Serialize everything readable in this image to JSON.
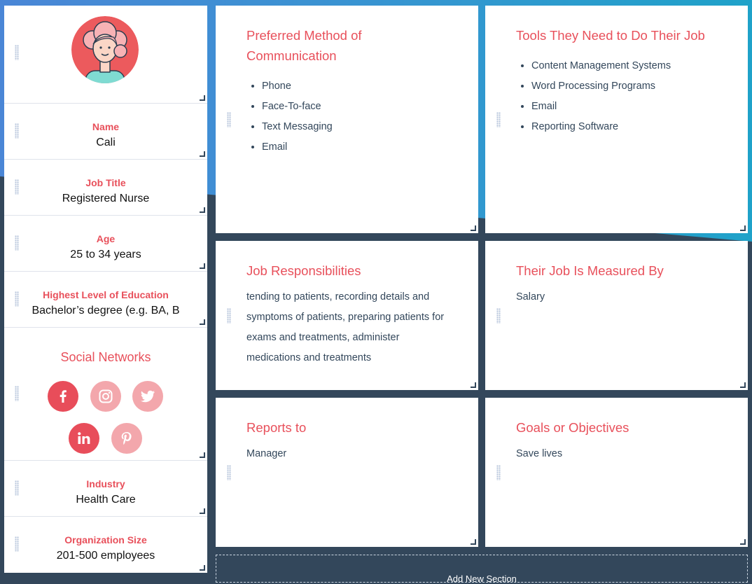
{
  "profile": {
    "name_label": "Name",
    "name_value": "Cali",
    "job_title_label": "Job Title",
    "job_title_value": "Registered Nurse",
    "age_label": "Age",
    "age_value": "25 to 34 years",
    "education_label": "Highest Level of Education",
    "education_value": "Bachelor’s degree (e.g. BA, B",
    "social_title": "Social Networks",
    "social": [
      {
        "name": "facebook",
        "active": true
      },
      {
        "name": "instagram",
        "active": false
      },
      {
        "name": "twitter",
        "active": false
      },
      {
        "name": "linkedin",
        "active": true
      },
      {
        "name": "pinterest",
        "active": false
      }
    ],
    "industry_label": "Industry",
    "industry_value": "Health Care",
    "org_size_label": "Organization Size",
    "org_size_value": "201-500 employees"
  },
  "cards": {
    "communication": {
      "title": "Preferred Method of Communication",
      "items": [
        "Phone",
        "Face-To-face",
        "Text Messaging",
        "Email"
      ]
    },
    "tools": {
      "title": "Tools They Need to Do Their Job",
      "items": [
        "Content Management Systems",
        "Word Processing Programs",
        "Email",
        "Reporting Software"
      ]
    },
    "responsibilities": {
      "title": "Job Responsibilities",
      "text": "tending to patients, recording details and symptoms of patients, preparing patients for exams and treatments, administer medications and treatments"
    },
    "measured": {
      "title": "Their Job Is Measured By",
      "text": "Salary"
    },
    "reports": {
      "title": "Reports to",
      "text": "Manager"
    },
    "goals": {
      "title": "Goals or Objectives",
      "text": "Save lives"
    }
  },
  "add_section_label": "Add New Section",
  "colors": {
    "accent": "#e8505b",
    "background": "#33475b",
    "sky": "#3a93d2",
    "social_active": "#e84d5a",
    "social_inactive": "#f3a7ac"
  }
}
